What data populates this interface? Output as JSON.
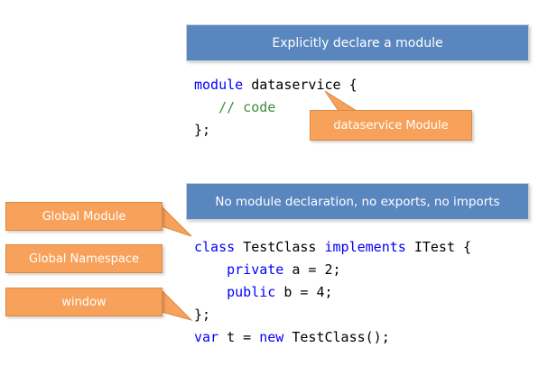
{
  "top_section": {
    "banner": "Explicitly declare a module",
    "code": {
      "line1": {
        "keyword": "module",
        "rest": " dataservice {"
      },
      "line2": {
        "comment": "// code"
      },
      "line3": {
        "text": "};"
      }
    },
    "callout": "dataservice Module"
  },
  "bottom_section": {
    "banner": "No module declaration, no exports, no imports",
    "code": {
      "line1": {
        "kw1": "class",
        "mid": " TestClass ",
        "kw2": "implements",
        "rest": " ITest {"
      },
      "line2": {
        "kw": "private",
        "rest": " a = 2;"
      },
      "line3": {
        "kw": "public",
        "rest": " b = 4;"
      },
      "line4": {
        "text": "};"
      },
      "line5": {
        "kw1": "var",
        "mid": " t = ",
        "kw2": "new",
        "rest": " TestClass();"
      }
    }
  },
  "left_callouts": {
    "global_module": "Global Module",
    "global_namespace": "Global Namespace",
    "window": "window"
  },
  "colors": {
    "banner_blue": "#5a86c0",
    "callout_orange": "#f7a15a",
    "keyword_blue": "#0000ff",
    "comment_green": "#3c8f3c"
  }
}
